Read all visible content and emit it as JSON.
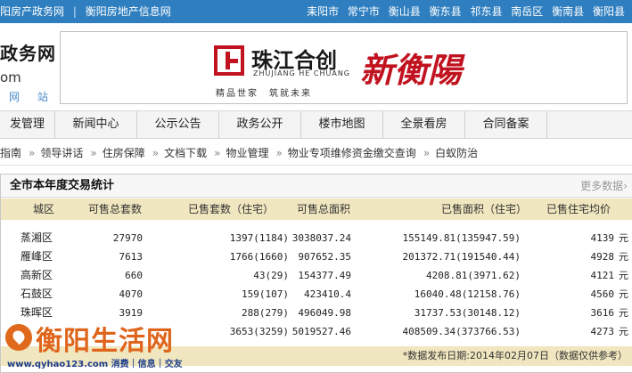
{
  "topbar": {
    "left_links": [
      "阳房产政务网",
      "衡阳房地产信息网"
    ],
    "separator": "|",
    "counties": [
      "耒阳市",
      "常宁市",
      "衡山县",
      "衡东县",
      "祁东县",
      "南岳区",
      "衡南县",
      "衡阳县"
    ]
  },
  "header": {
    "logo_main": "政务网",
    "logo_sub": "om",
    "logo_tag": "网站",
    "banner": {
      "brand": "珠江合创",
      "brand_pinyin": "ZHUJIANG HE CHUANG",
      "slogan": "精品世家　筑就未来",
      "calligraphy": "新衡陽"
    }
  },
  "nav": {
    "items": [
      "发管理",
      "新闻中心",
      "公示公告",
      "政务公开",
      "楼市地图",
      "全景看房",
      "合同备案"
    ]
  },
  "subbar": {
    "links": [
      "指南",
      "领导讲话",
      "住房保障",
      "文档下载",
      "物业管理",
      "物业专项维修资金缴交查询",
      "白蚁防治"
    ],
    "arrow": "»"
  },
  "stats": {
    "title": "全市本年度交易统计",
    "more": "更多数据",
    "more_arrow": "›",
    "columns": [
      "城区",
      "可售总套数",
      "已售套数（住宅）",
      "可售总面积",
      "已售面积（住宅）",
      "已售住宅均价"
    ],
    "unit": "元",
    "rows": [
      {
        "district": "蒸湘区",
        "available_units": "27970",
        "sold_units": "1397(1184)",
        "available_area": "3038037.24",
        "sold_area": "155149.81(135947.59)",
        "avg_price": "4139"
      },
      {
        "district": "雁峰区",
        "available_units": "7613",
        "sold_units": "1766(1660)",
        "available_area": "907652.35",
        "sold_area": "201372.71(191540.44)",
        "avg_price": "4928"
      },
      {
        "district": "高新区",
        "available_units": "660",
        "sold_units": "43(29)",
        "available_area": "154377.49",
        "sold_area": "4208.81(3971.62)",
        "avg_price": "4121"
      },
      {
        "district": "石鼓区",
        "available_units": "4070",
        "sold_units": "159(107)",
        "available_area": "423410.4",
        "sold_area": "16040.48(12158.76)",
        "avg_price": "4560"
      },
      {
        "district": "珠晖区",
        "available_units": "3919",
        "sold_units": "288(279)",
        "available_area": "496049.98",
        "sold_area": "31737.53(30148.12)",
        "avg_price": "3616"
      },
      {
        "district": "",
        "available_units": "",
        "sold_units": "3653(3259)",
        "available_area": "5019527.46",
        "sold_area": "408509.34(373766.53)",
        "avg_price": "4273"
      }
    ],
    "footnote": "*数据发布日期:2014年02月07日（数据仅供参考）"
  },
  "watermark": {
    "name": "衡阳生活网",
    "url_line": "www.qyhao123.com 消费｜信息｜交友"
  },
  "colors": {
    "topbar": "#2f7fc0",
    "table_header": "#f0e6bf",
    "brand_red": "#c1121f",
    "watermark_orange": "#e0651c"
  }
}
